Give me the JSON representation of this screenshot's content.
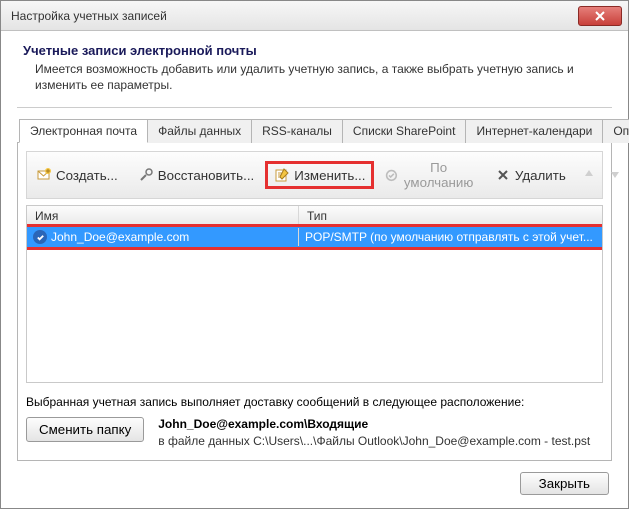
{
  "window": {
    "title": "Настройка учетных записей"
  },
  "header": {
    "heading": "Учетные записи электронной почты",
    "sub": "Имеется возможность добавить или удалить учетную запись, а также выбрать учетную запись и изменить ее параметры."
  },
  "tabs": [
    {
      "label": "Электронная почта",
      "active": true
    },
    {
      "label": "Файлы данных"
    },
    {
      "label": "RSS-каналы"
    },
    {
      "label": "Списки SharePoint"
    },
    {
      "label": "Интернет-календари"
    },
    {
      "label": "Опубликован"
    }
  ],
  "toolbar": {
    "create": "Создать...",
    "restore": "Восстановить...",
    "edit": "Изменить...",
    "default": "По умолчанию",
    "delete": "Удалить"
  },
  "table": {
    "columns": {
      "name": "Имя",
      "type": "Тип"
    },
    "rows": [
      {
        "name": "John_Doe@example.com",
        "type": "POP/SMTP (по умолчанию отправлять с этой учет..."
      }
    ]
  },
  "delivery": {
    "intro": "Выбранная учетная запись выполняет доставку сообщений в следующее расположение:",
    "change_folder": "Сменить папку",
    "path_main": "John_Doe@example.com\\Входящие",
    "path_sub": "в файле данных C:\\Users\\...\\Файлы Outlook\\John_Doe@example.com - test.pst"
  },
  "footer": {
    "close": "Закрыть"
  }
}
